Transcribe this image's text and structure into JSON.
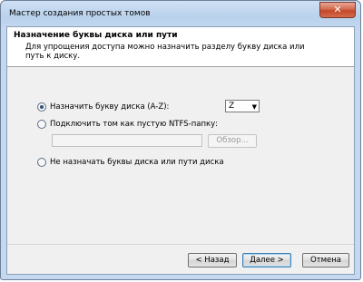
{
  "window": {
    "title": "Мастер создания простых томов",
    "close_glyph": "✕"
  },
  "header": {
    "title": "Назначение буквы диска или пути",
    "description": "Для упрощения доступа можно назначить разделу букву диска или путь к диску."
  },
  "options": {
    "assign_letter": {
      "label": "Назначить букву диска (A-Z):",
      "checked": true
    },
    "mount_folder": {
      "label": "Подключить том как пустую NTFS-папку:",
      "checked": false
    },
    "no_letter": {
      "label": "Не назначать буквы диска или пути диска",
      "checked": false
    }
  },
  "drive_select": {
    "value": "Z",
    "arrow": "▼"
  },
  "folder_path": {
    "value": ""
  },
  "buttons": {
    "browse": "Обзор...",
    "back": "< Назад",
    "next": "Далее >",
    "cancel": "Отмена"
  }
}
